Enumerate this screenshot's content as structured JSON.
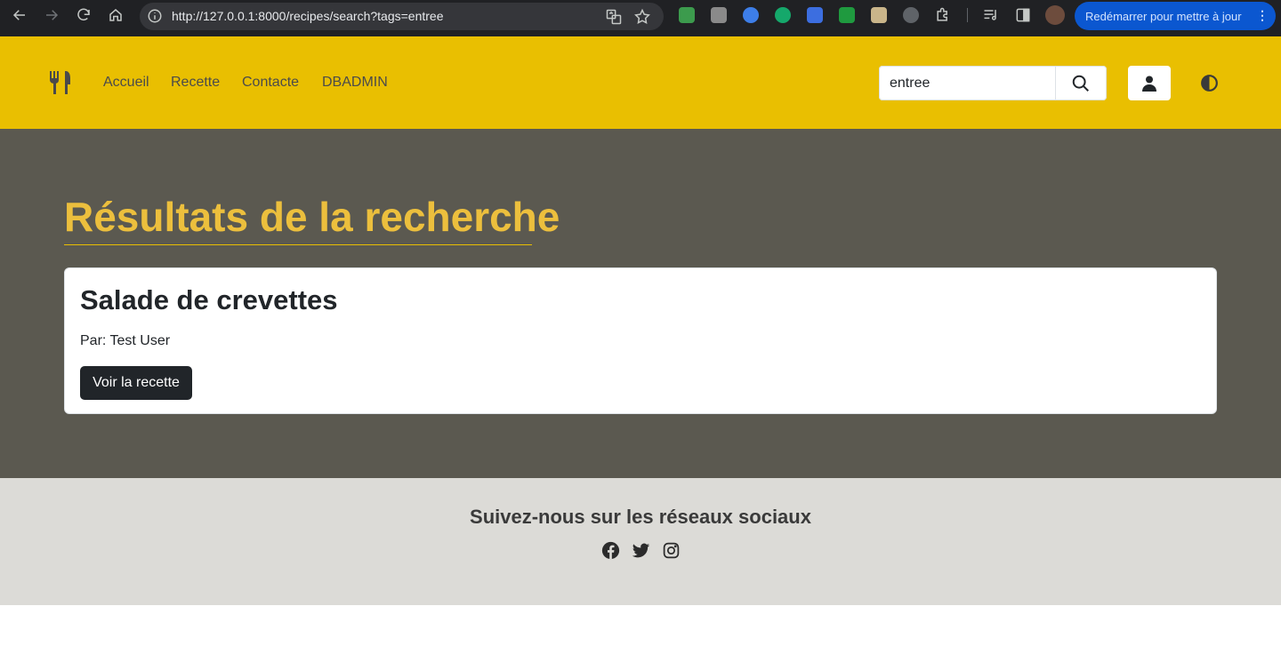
{
  "browser": {
    "url": "http://127.0.0.1:8000/recipes/search?tags=entree",
    "restart_label": "Redémarrer pour mettre à jour",
    "nav_icons": [
      "back-icon",
      "forward-icon",
      "reload-icon",
      "home-icon"
    ],
    "omnibox_icons": [
      "site-info-icon",
      "translate-icon",
      "bookmark-star-icon"
    ],
    "extension_icons": [
      "extension-1-icon",
      "extension-2-icon",
      "extension-3-icon",
      "grammarly-icon",
      "extension-5-icon",
      "extension-6-icon",
      "extension-7-icon",
      "extension-8-icon",
      "puzzle-icon",
      "media-icon",
      "side-panel-icon",
      "profile-avatar-icon"
    ]
  },
  "navbar": {
    "brand_icon": "utensils-icon",
    "links": [
      "Accueil",
      "Recette",
      "Contacte",
      "DBADMIN"
    ],
    "search_value": "entree",
    "search_icon": "search-icon",
    "user_icon": "user-icon",
    "theme_icon": "contrast-icon",
    "bg_color": "#e9bf01"
  },
  "main": {
    "title": "Résultats de la recherche",
    "title_color": "#ecbf3d",
    "bg_color": "#5b5950",
    "results": [
      {
        "title": "Salade de crevettes",
        "author": "Par: Test User",
        "button_label": "Voir la recette"
      }
    ]
  },
  "footer": {
    "title": "Suivez-nous sur les réseaux sociaux",
    "social_icons": [
      "facebook-icon",
      "twitter-icon",
      "instagram-icon"
    ],
    "bg_color": "#dcdbd7"
  }
}
